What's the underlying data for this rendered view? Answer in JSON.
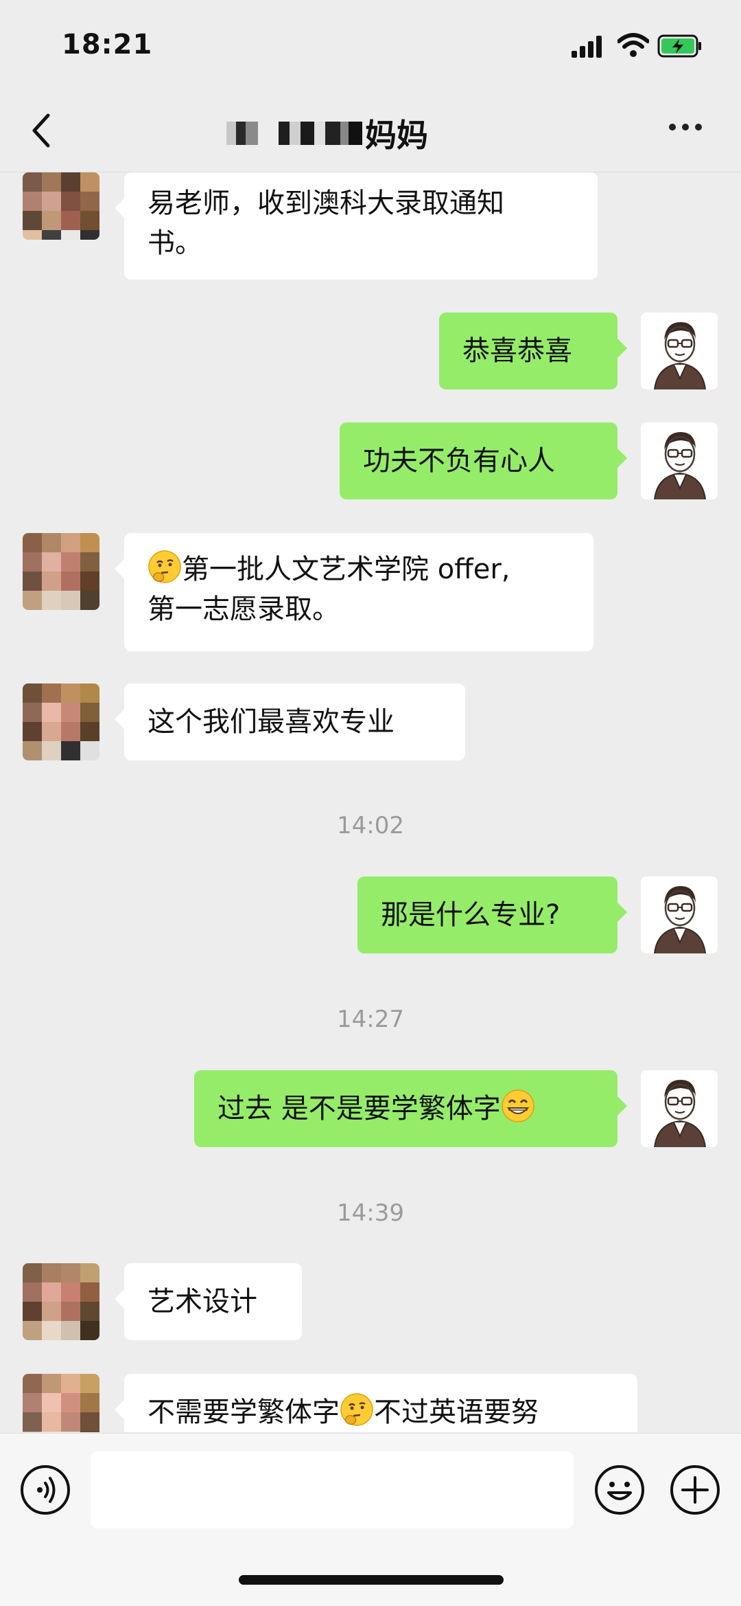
{
  "status_bar": {
    "time": "18:21"
  },
  "nav": {
    "title_suffix": "妈妈"
  },
  "messages": [
    {
      "side": "left",
      "line1": "易老师，收到澳科大录取通知",
      "line2": "书。"
    },
    {
      "side": "right",
      "text": "恭喜恭喜"
    },
    {
      "side": "right",
      "text": "功夫不负有心人"
    },
    {
      "side": "left",
      "emoji": "thinking-emoji",
      "line1": "第一批人文艺术学院 offer,",
      "line2": "第一志愿录取。"
    },
    {
      "side": "left",
      "text": "这个我们最喜欢专业"
    },
    {
      "type": "timestamp",
      "text": "14:02"
    },
    {
      "side": "right",
      "text": "那是什么专业?"
    },
    {
      "type": "timestamp",
      "text": "14:27"
    },
    {
      "side": "right",
      "text": "过去 是不是要学繁体字",
      "emoji": "grinning-emoji"
    },
    {
      "type": "timestamp",
      "text": "14:39"
    },
    {
      "side": "left",
      "text": "艺术设计"
    },
    {
      "side": "left",
      "text_before": "不需要学繁体字",
      "emoji": "thinking-emoji",
      "text_after": "不过英语要努"
    }
  ],
  "colors": {
    "background": "#ededed",
    "right_bubble": "#95ec69",
    "left_bubble": "#ffffff",
    "timestamp": "#9a9a9a"
  }
}
